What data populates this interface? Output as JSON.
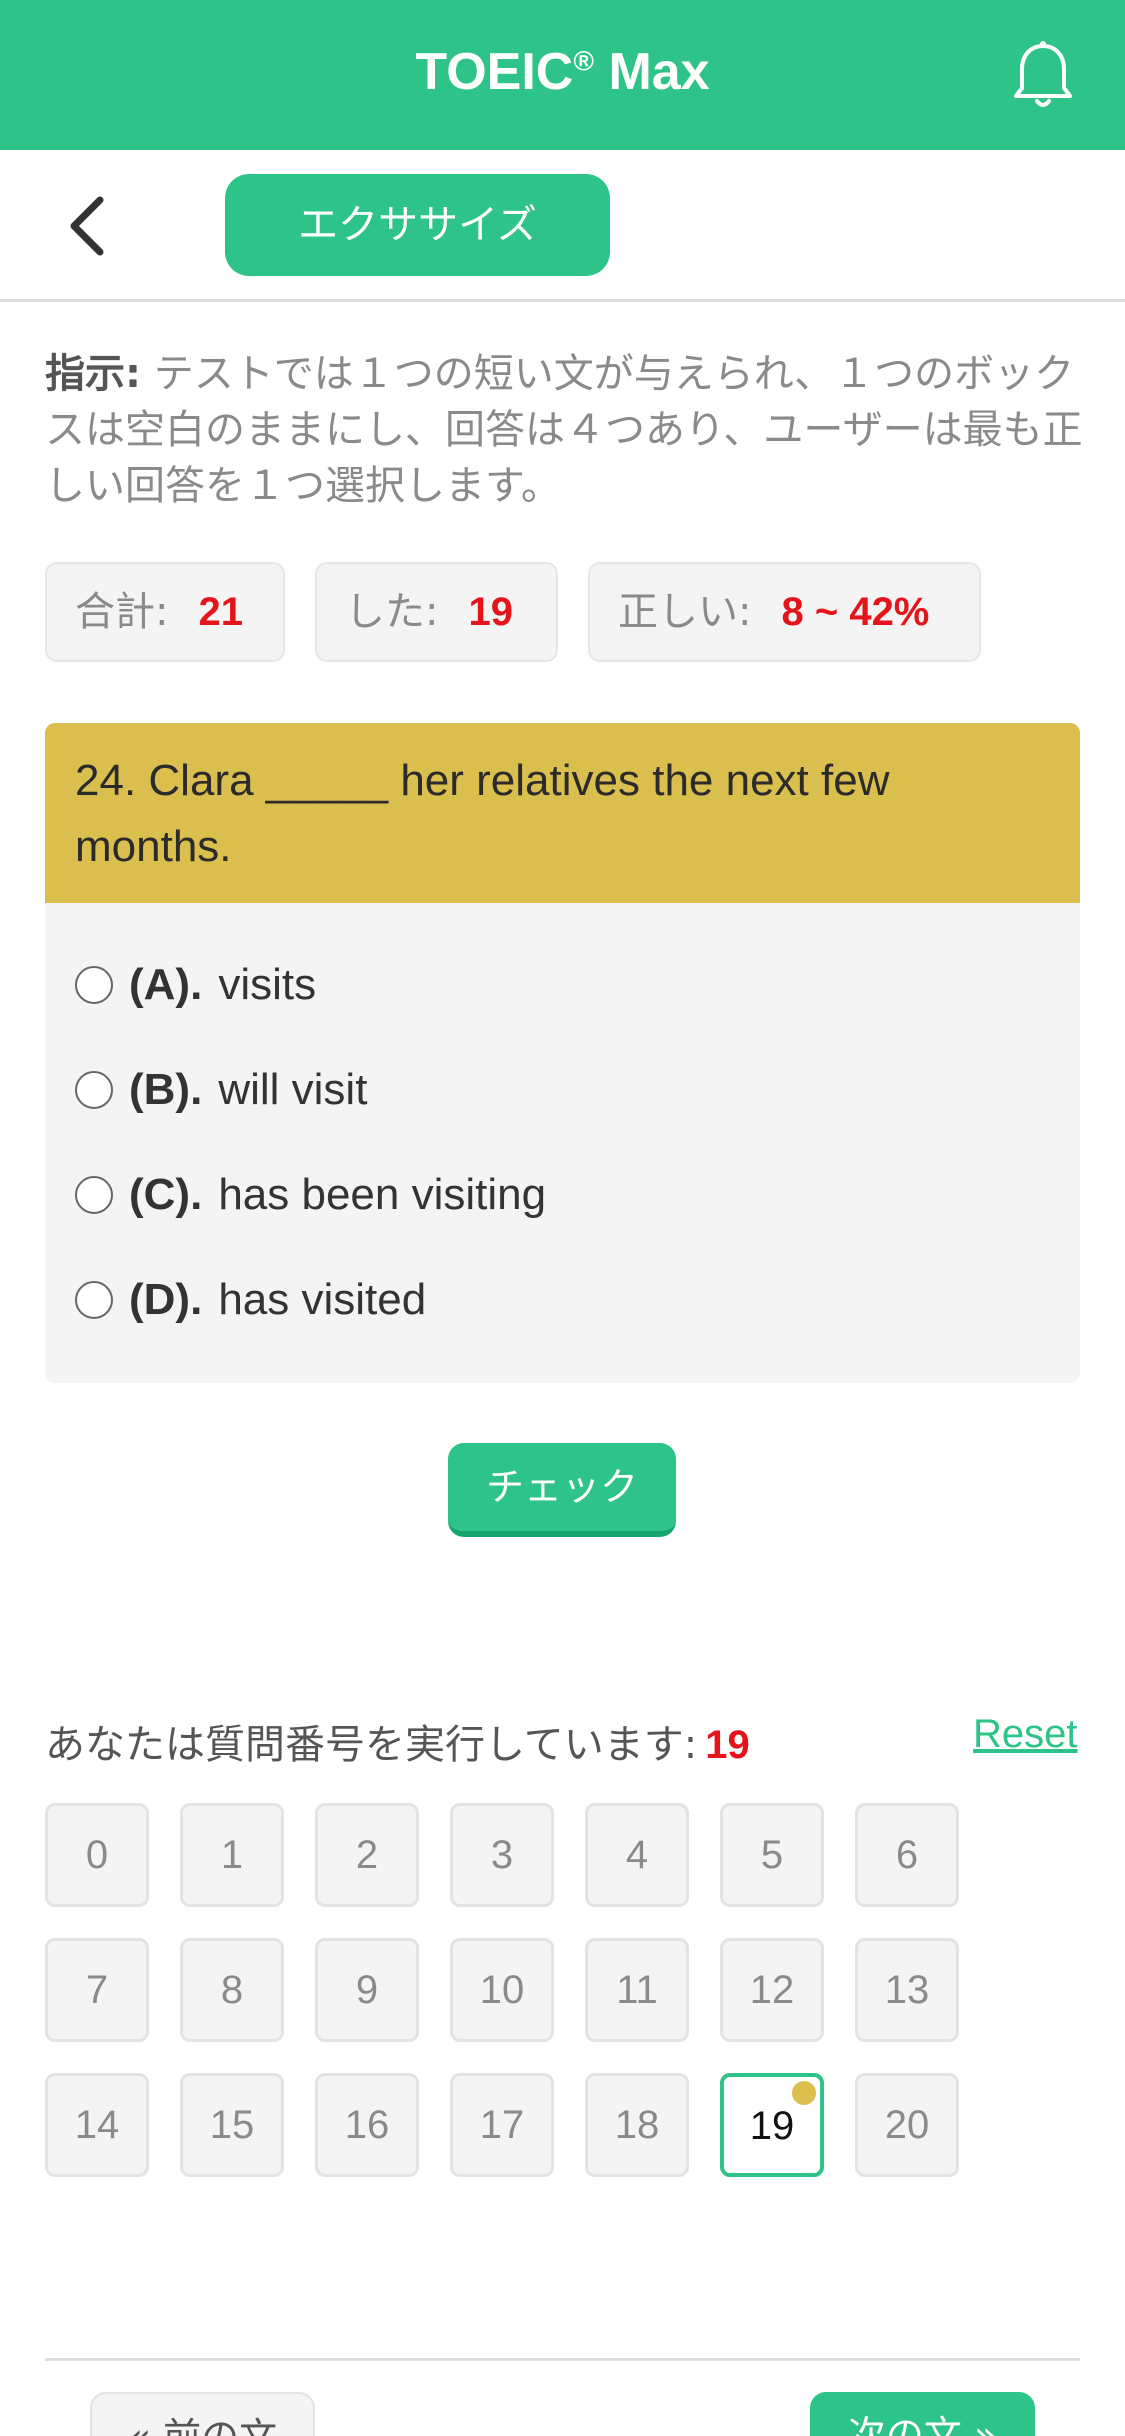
{
  "header": {
    "title_main": "TOEIC",
    "title_reg": "®",
    "title_suffix": " Max",
    "bell_icon": "bell-icon"
  },
  "subheader": {
    "back_icon": "chevron-left-icon",
    "tab_label": "エクササイズ"
  },
  "instructions": {
    "label": "指示:",
    "text": " テストでは１つの短い文が与えられ、１つのボックスは空白のままにし、回答は４つあり、ユーザーは最も正しい回答を１つ選択します。"
  },
  "stats": [
    {
      "label": "合計:",
      "value": "21"
    },
    {
      "label": "した:",
      "value": "19"
    },
    {
      "label": "正しい:",
      "value": "8 ~ 42%"
    }
  ],
  "question": {
    "text": "24. Clara _____ her relatives the next few months.",
    "options": [
      {
        "letter": "(A).",
        "text": "visits"
      },
      {
        "letter": "(B).",
        "text": "will visit"
      },
      {
        "letter": "(C).",
        "text": "has been visiting"
      },
      {
        "letter": "(D).",
        "text": "has visited"
      }
    ]
  },
  "check_label": "チェック",
  "progress": {
    "label": "あなたは質問番号を実行しています:",
    "current": "19",
    "reset_label": "Reset"
  },
  "question_numbers": [
    "0",
    "1",
    "2",
    "3",
    "4",
    "5",
    "6",
    "7",
    "8",
    "9",
    "10",
    "11",
    "12",
    "13",
    "14",
    "15",
    "16",
    "17",
    "18",
    "19",
    "20"
  ],
  "active_number": "19",
  "nav": {
    "prev_label": "« 前の文",
    "next_label": "次の文 »"
  },
  "colors": {
    "accent": "#2ec489",
    "question_header": "#dbbf4e",
    "highlight_number": "#e4141b"
  }
}
